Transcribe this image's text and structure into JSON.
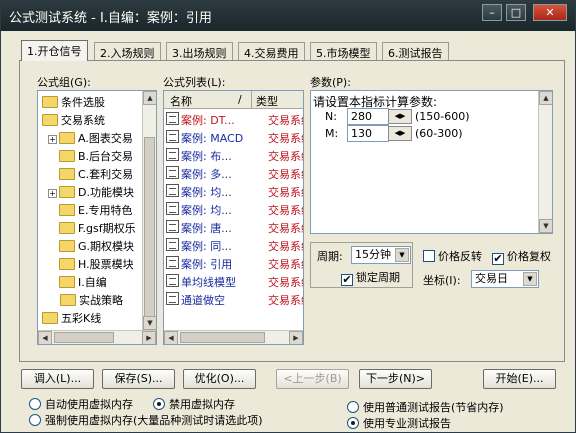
{
  "window": {
    "title": "公式测试系统 - I.自编：案例：引用"
  },
  "tabs": [
    "1.开仓信号",
    "2.入场规则",
    "3.出场规则",
    "4.交易费用",
    "5.市场模型",
    "6.测试报告"
  ],
  "formula_group": {
    "label": "公式组(G):",
    "items": [
      "条件选股",
      "交易系统",
      "A.图表交易",
      "B.后台交易",
      "C.套利交易",
      "D.功能模块",
      "E.专用特色",
      "F.gsf期权乐",
      "G.期权模块",
      "H.股票模块",
      "I.自编",
      "实战策略",
      "五彩K线"
    ]
  },
  "formula_list": {
    "label": "公式列表(L):",
    "col_name": "名称",
    "col_sort": "/",
    "col_type": "类型",
    "rows": [
      {
        "name": "案例: DT...",
        "type": "交易系统",
        "name_color": "#c0101a",
        "type_color": "#c0101a"
      },
      {
        "name": "案例: MACD",
        "type": "交易系统",
        "name_color": "#1a2a9e",
        "type_color": "#c0101a"
      },
      {
        "name": "案例: 布...",
        "type": "交易系统",
        "name_color": "#1a2a9e",
        "type_color": "#c0101a"
      },
      {
        "name": "案例: 多...",
        "type": "交易系统",
        "name_color": "#1a2a9e",
        "type_color": "#c0101a"
      },
      {
        "name": "案例: 均...",
        "type": "交易系统",
        "name_color": "#1a2a9e",
        "type_color": "#c0101a"
      },
      {
        "name": "案例: 均...",
        "type": "交易系统",
        "name_color": "#1a2a9e",
        "type_color": "#c0101a"
      },
      {
        "name": "案例: 唐...",
        "type": "交易系统",
        "name_color": "#1a2a9e",
        "type_color": "#c0101a"
      },
      {
        "name": "案例: 同...",
        "type": "交易系统",
        "name_color": "#1a2a9e",
        "type_color": "#c0101a"
      },
      {
        "name": "案例: 引用",
        "type": "交易系统",
        "name_color": "#1a2a9e",
        "type_color": "#c0101a"
      },
      {
        "name": "单均线模型",
        "type": "交易系统",
        "name_color": "#1a2a9e",
        "type_color": "#c0101a"
      },
      {
        "name": "通道做空",
        "type": "交易系统",
        "name_color": "#1a2a9e",
        "type_color": "#c0101a"
      }
    ]
  },
  "params": {
    "label": "参数(P):",
    "heading": "请设置本指标计算参数:",
    "items": [
      {
        "name": "N:",
        "value": "280",
        "range": "(150-600)"
      },
      {
        "name": "M:",
        "value": "130",
        "range": "(60-300)"
      }
    ]
  },
  "period": {
    "label": "周期:",
    "value": "15分钟",
    "lock_label": "锁定周期",
    "lock_checked": "✔"
  },
  "price_reverse": {
    "label": "价格反转",
    "checked": ""
  },
  "price_restore": {
    "label": "价格复权",
    "checked": "✔"
  },
  "coord": {
    "label": "坐标(I):",
    "value": "交易日"
  },
  "buttons": {
    "load": "调入(L)...",
    "save": "保存(S)...",
    "optimize": "优化(O)...",
    "prev": "<上一步(B)",
    "next": "下一步(N)>",
    "start": "开始(E)..."
  },
  "memory_options": [
    {
      "label": "自动使用虚拟内存",
      "selected": false
    },
    {
      "label": "禁用虚拟内存",
      "selected": true
    },
    {
      "label": "强制使用虚拟内存(大量品种测试时请选此项)",
      "selected": false
    }
  ],
  "report_options": [
    {
      "label": "使用普通测试报告(节省内存)",
      "selected": false
    },
    {
      "label": "使用专业测试报告",
      "selected": true
    }
  ]
}
